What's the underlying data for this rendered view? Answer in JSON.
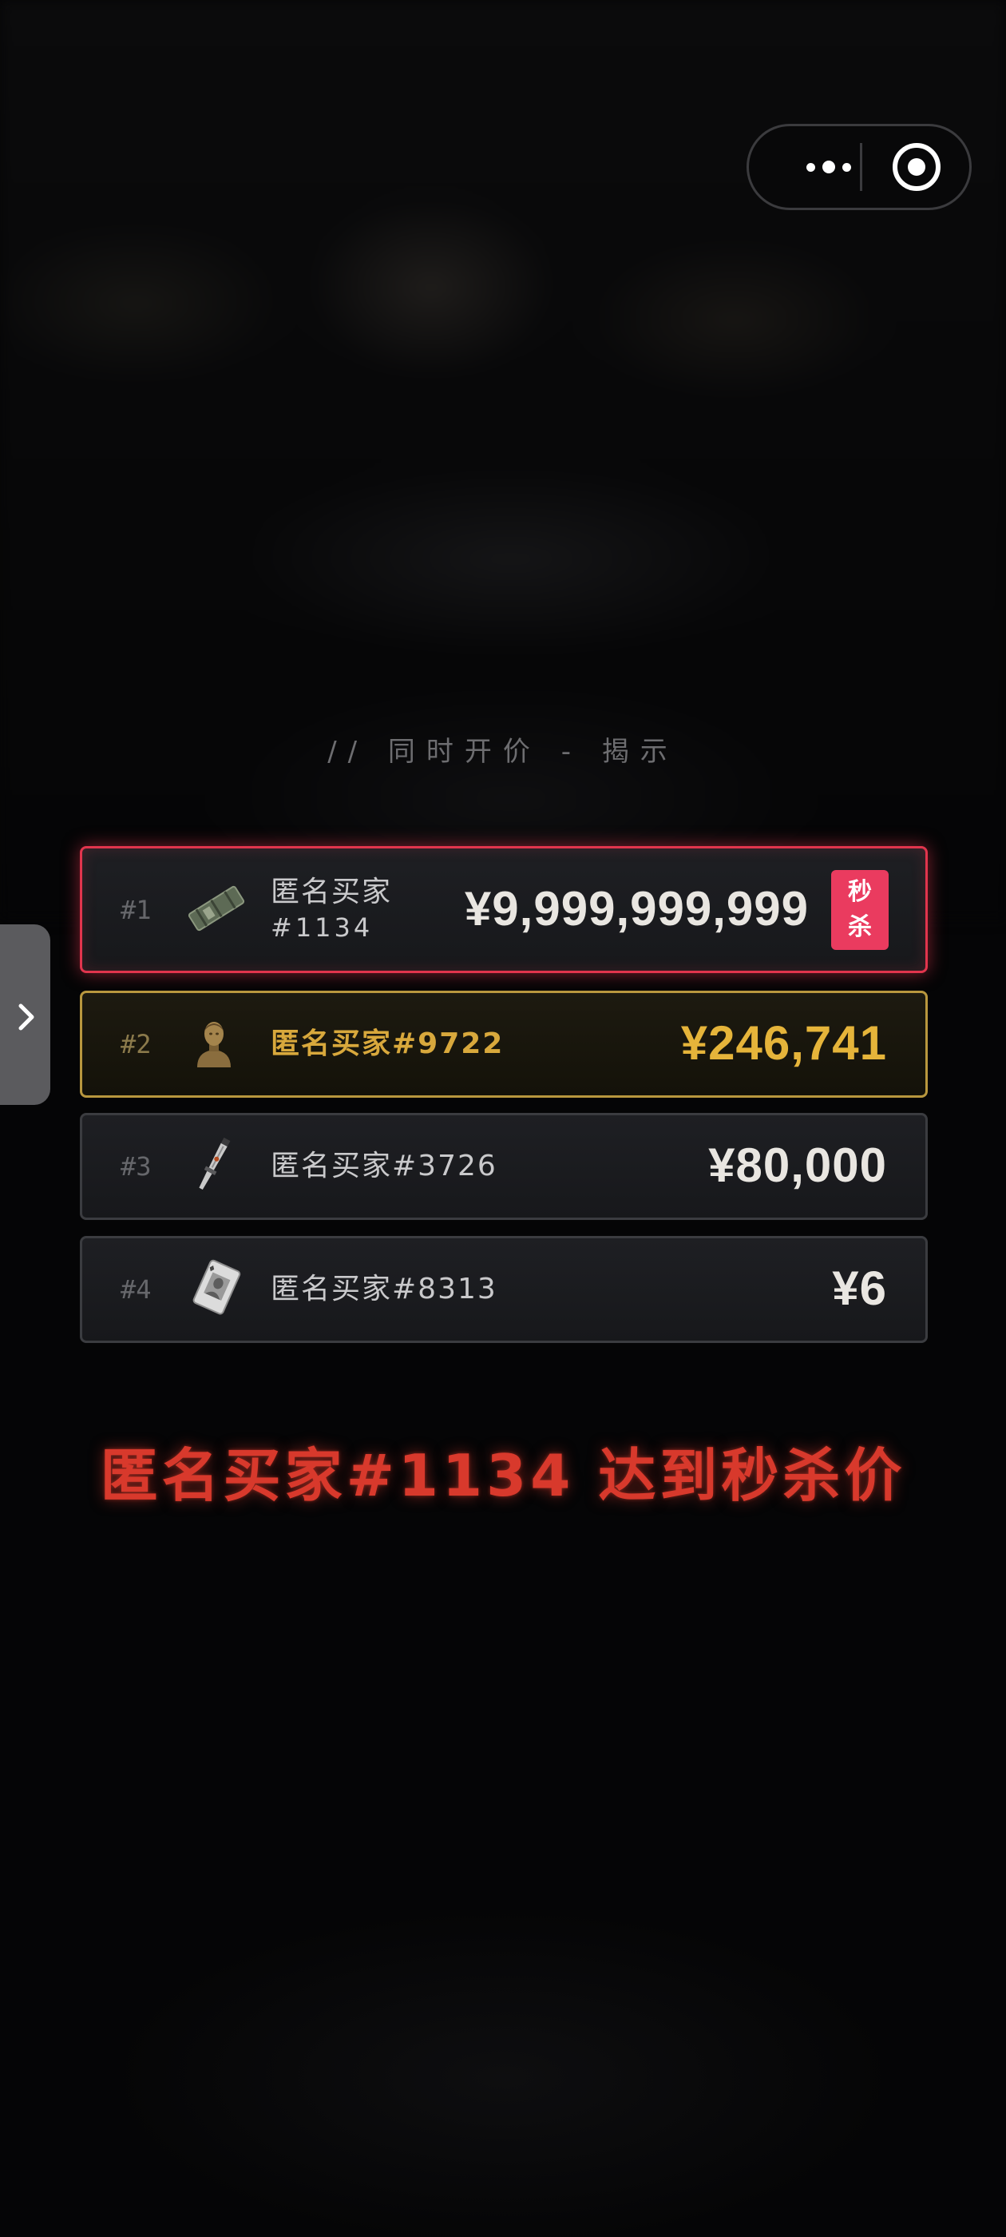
{
  "subtitle": "// 同时开价 - 揭示",
  "bids": [
    {
      "rank": "#1",
      "name_line1": "匿名买家",
      "name_line2": "#1134",
      "price": "¥9,999,999,999",
      "badge": [
        "秒",
        "杀"
      ],
      "item_icon": "wrapped-package-icon"
    },
    {
      "rank": "#2",
      "name": "匿名买家#9722",
      "price": "¥246,741",
      "item_icon": "bronze-bust-icon"
    },
    {
      "rank": "#3",
      "name": "匿名买家#3726",
      "price": "¥80,000",
      "item_icon": "knife-icon"
    },
    {
      "rank": "#4",
      "name": "匿名买家#8313",
      "price": "¥6",
      "item_icon": "playing-card-icon"
    }
  ],
  "announcement": "匿名买家#1134 达到秒杀价",
  "colors": {
    "highlight_red": "#e1354d",
    "gold": "#d8a83c",
    "badge_pink": "#ea3b5f",
    "announce_red": "#d8392c"
  }
}
